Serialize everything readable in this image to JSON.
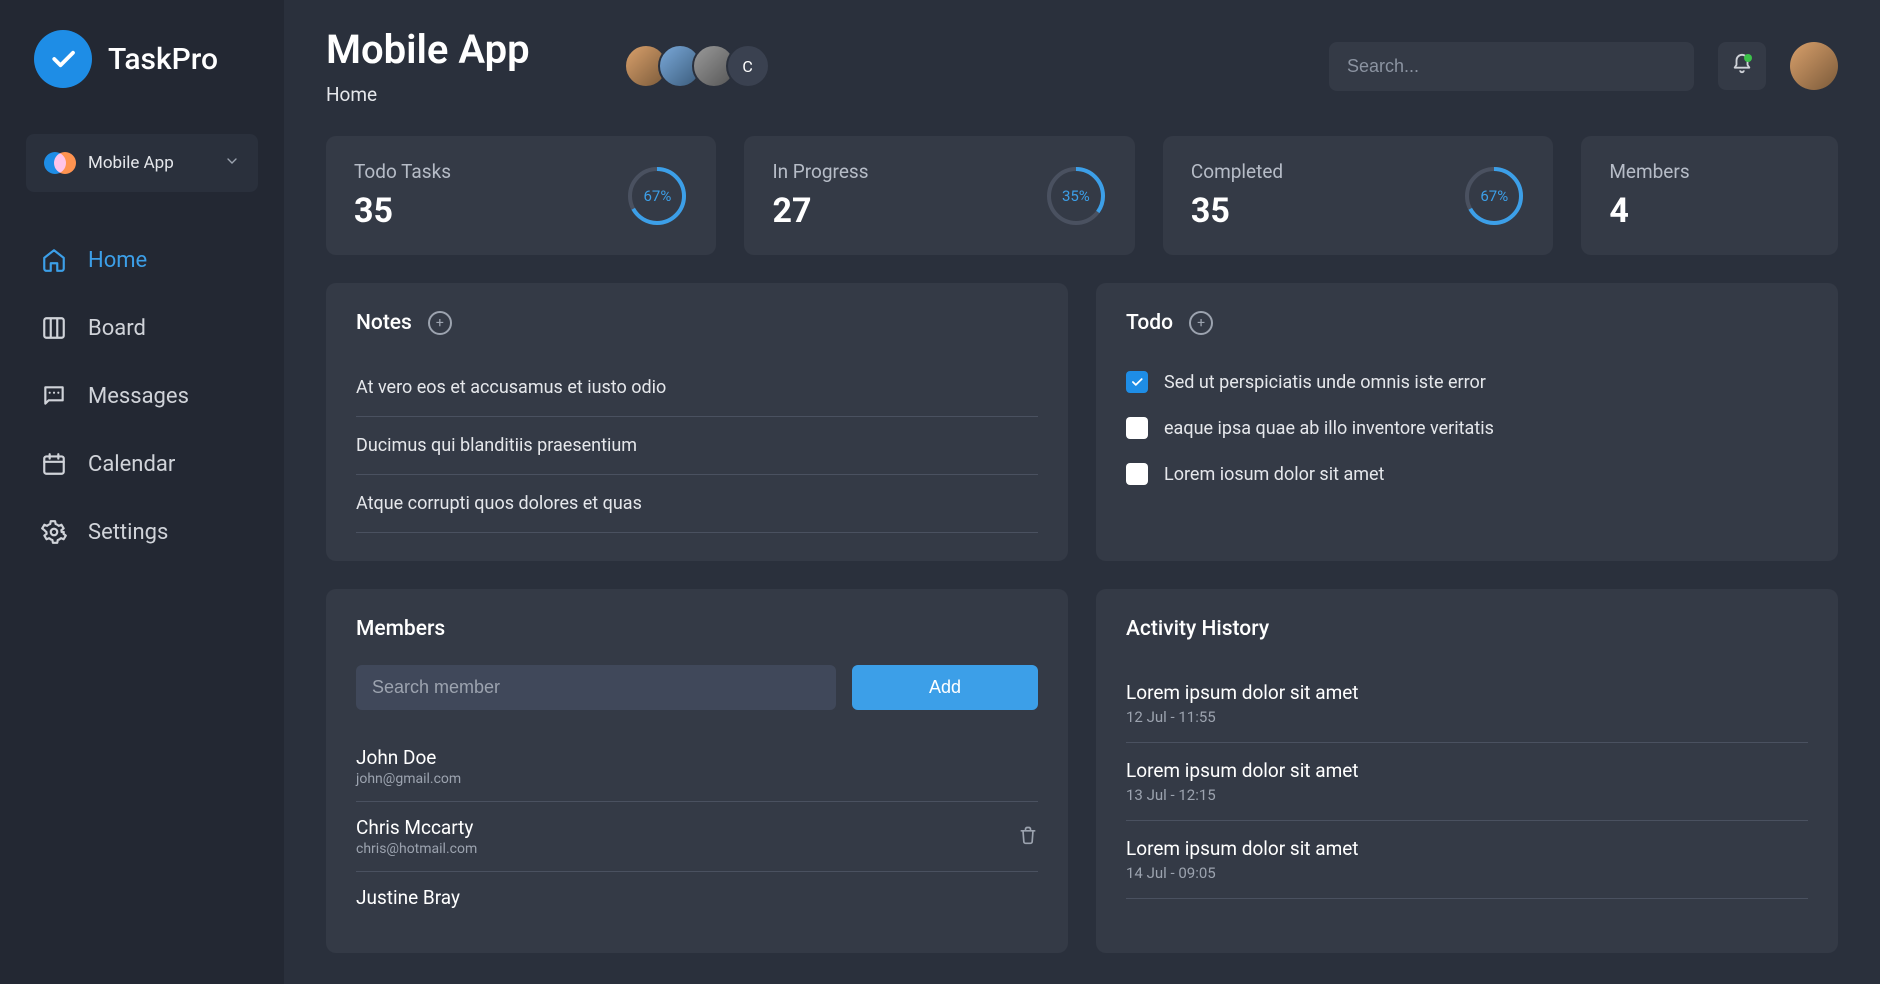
{
  "brand": {
    "name": "TaskPro"
  },
  "project": {
    "name": "Mobile App"
  },
  "nav": {
    "home": "Home",
    "board": "Board",
    "messages": "Messages",
    "calendar": "Calendar",
    "settings": "Settings"
  },
  "header": {
    "title": "Mobile App",
    "breadcrumb": "Home",
    "search_placeholder": "Search...",
    "avatar_overflow_letter": "C"
  },
  "stats": {
    "todo": {
      "label": "Todo Tasks",
      "value": "35",
      "percent": "67%",
      "pct": 67
    },
    "progress": {
      "label": "In Progress",
      "value": "27",
      "percent": "35%",
      "pct": 35
    },
    "completed": {
      "label": "Completed",
      "value": "35",
      "percent": "67%",
      "pct": 67
    },
    "members": {
      "label": "Members",
      "value": "4"
    }
  },
  "notes": {
    "title": "Notes",
    "items": [
      "At vero eos et accusamus et iusto odio",
      "Ducimus qui blanditiis praesentium",
      "Atque corrupti quos dolores et quas"
    ]
  },
  "todo": {
    "title": "Todo",
    "items": [
      {
        "text": "Sed ut perspiciatis unde omnis iste error",
        "checked": true
      },
      {
        "text": "eaque ipsa quae ab illo inventore veritatis",
        "checked": false
      },
      {
        "text": "Lorem iosum dolor sit amet",
        "checked": false
      }
    ]
  },
  "members": {
    "title": "Members",
    "search_placeholder": "Search member",
    "add_label": "Add",
    "items": [
      {
        "name": "John Doe",
        "email": "john@gmail.com",
        "deletable": false
      },
      {
        "name": "Chris Mccarty",
        "email": "chris@hotmail.com",
        "deletable": true
      },
      {
        "name": "Justine Bray",
        "email": "",
        "deletable": false
      }
    ]
  },
  "activity": {
    "title": "Activity History",
    "items": [
      {
        "text": "Lorem ipsum dolor sit amet",
        "time": "12 Jul - 11:55"
      },
      {
        "text": "Lorem ipsum dolor sit amet",
        "time": "13 Jul - 12:15"
      },
      {
        "text": "Lorem ipsum dolor sit amet",
        "time": "14 Jul - 09:05"
      }
    ]
  }
}
